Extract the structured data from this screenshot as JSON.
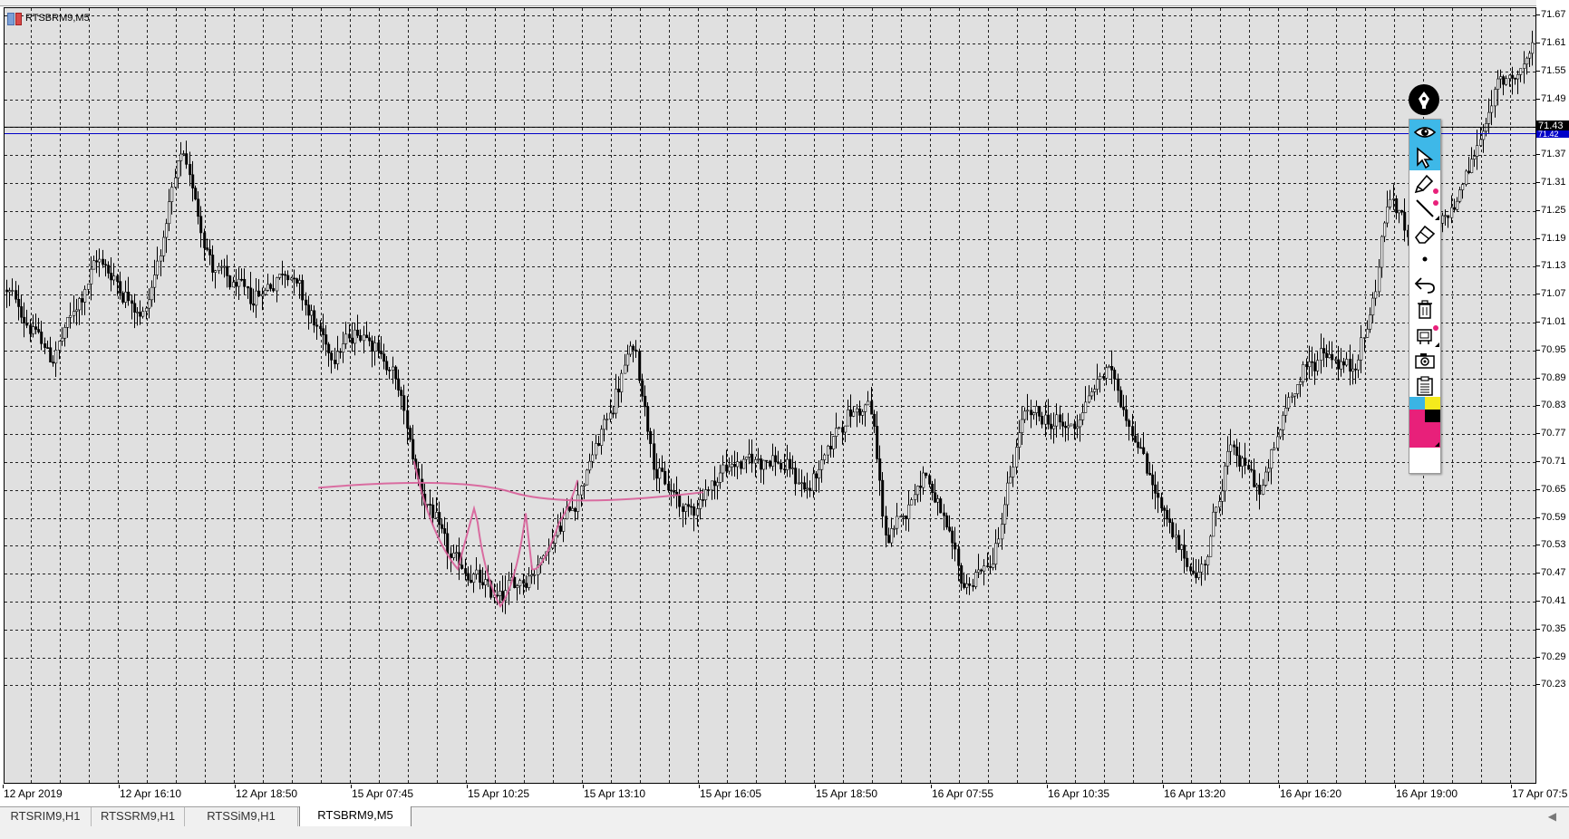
{
  "chart": {
    "symbol_title": "RTSBRM9,M5",
    "price_labels": [
      "71.67",
      "71.61",
      "71.55",
      "71.49",
      "71.43",
      "71.37",
      "71.31",
      "71.25",
      "71.19",
      "71.13",
      "71.07",
      "71.01",
      "70.95",
      "70.89",
      "70.83",
      "70.77",
      "70.71",
      "70.65",
      "70.59",
      "70.53",
      "70.47",
      "70.41",
      "70.35",
      "70.29",
      "70.23"
    ],
    "current_price_label": "71.43",
    "blue_line_price_label": "71.42",
    "time_labels": [
      "12 Apr 2019",
      "12 Apr 16:10",
      "12 Apr 18:50",
      "15 Apr 07:45",
      "15 Apr 10:25",
      "15 Apr 13:10",
      "15 Apr 16:05",
      "15 Apr 18:50",
      "16 Apr 07:55",
      "16 Apr 10:35",
      "16 Apr 13:20",
      "16 Apr 16:20",
      "16 Apr 19:00",
      "17 Apr 07:5"
    ],
    "colors": {
      "background": "#e0e0e0",
      "grid": "#000000",
      "candle": "#000000",
      "ask_line": "#0000c8",
      "bid_line": "#000000",
      "drawing": "#d9609a"
    }
  },
  "chart_data": {
    "type": "candlestick",
    "title": "RTSBRM9,M5",
    "ylim": [
      70.2,
      71.67
    ],
    "y_ticks": [
      71.67,
      71.61,
      71.55,
      71.49,
      71.43,
      71.37,
      71.31,
      71.25,
      71.19,
      71.13,
      71.07,
      71.01,
      70.95,
      70.89,
      70.83,
      70.77,
      70.71,
      70.65,
      70.59,
      70.53,
      70.47,
      70.41,
      70.35,
      70.29,
      70.23
    ],
    "x_ticks": [
      "12 Apr 2019",
      "12 Apr 16:10",
      "12 Apr 18:50",
      "15 Apr 07:45",
      "15 Apr 10:25",
      "15 Apr 13:10",
      "15 Apr 16:05",
      "15 Apr 18:50",
      "16 Apr 07:55",
      "16 Apr 10:35",
      "16 Apr 13:20",
      "16 Apr 16:20",
      "16 Apr 19:00",
      "17 Apr 07:5"
    ],
    "grid": true,
    "anchors": [
      {
        "x": 0,
        "y": 71.08
      },
      {
        "x": 0.03,
        "y": 70.93
      },
      {
        "x": 0.06,
        "y": 71.15
      },
      {
        "x": 0.09,
        "y": 71.02
      },
      {
        "x": 0.115,
        "y": 71.38
      },
      {
        "x": 0.135,
        "y": 71.12
      },
      {
        "x": 0.16,
        "y": 71.06
      },
      {
        "x": 0.185,
        "y": 71.13
      },
      {
        "x": 0.21,
        "y": 70.94
      },
      {
        "x": 0.235,
        "y": 71.0
      },
      {
        "x": 0.255,
        "y": 70.88
      },
      {
        "x": 0.27,
        "y": 70.66
      },
      {
        "x": 0.29,
        "y": 70.5
      },
      {
        "x": 0.32,
        "y": 70.42
      },
      {
        "x": 0.345,
        "y": 70.48
      },
      {
        "x": 0.37,
        "y": 70.62
      },
      {
        "x": 0.39,
        "y": 70.78
      },
      {
        "x": 0.41,
        "y": 70.97
      },
      {
        "x": 0.425,
        "y": 70.68
      },
      {
        "x": 0.445,
        "y": 70.6
      },
      {
        "x": 0.47,
        "y": 70.7
      },
      {
        "x": 0.5,
        "y": 70.72
      },
      {
        "x": 0.525,
        "y": 70.65
      },
      {
        "x": 0.545,
        "y": 70.8
      },
      {
        "x": 0.565,
        "y": 70.84
      },
      {
        "x": 0.575,
        "y": 70.52
      },
      {
        "x": 0.6,
        "y": 70.7
      },
      {
        "x": 0.625,
        "y": 70.44
      },
      {
        "x": 0.645,
        "y": 70.5
      },
      {
        "x": 0.665,
        "y": 70.82
      },
      {
        "x": 0.695,
        "y": 70.78
      },
      {
        "x": 0.72,
        "y": 70.92
      },
      {
        "x": 0.745,
        "y": 70.7
      },
      {
        "x": 0.765,
        "y": 70.52
      },
      {
        "x": 0.78,
        "y": 70.46
      },
      {
        "x": 0.8,
        "y": 70.75
      },
      {
        "x": 0.82,
        "y": 70.64
      },
      {
        "x": 0.84,
        "y": 70.87
      },
      {
        "x": 0.86,
        "y": 70.95
      },
      {
        "x": 0.88,
        "y": 70.9
      },
      {
        "x": 0.893,
        "y": 71.05
      },
      {
        "x": 0.903,
        "y": 71.29
      },
      {
        "x": 0.92,
        "y": 71.17
      },
      {
        "x": 0.94,
        "y": 71.22
      },
      {
        "x": 0.96,
        "y": 71.38
      },
      {
        "x": 0.975,
        "y": 71.52
      },
      {
        "x": 0.99,
        "y": 71.56
      },
      {
        "x": 1.0,
        "y": 71.6
      }
    ],
    "annotations": [
      "hand-drawn pink neckline near 70.64",
      "hand-drawn pink inverse head-and-shoulders around 15 Apr 10:25"
    ]
  },
  "tabs": [
    "RTSRIM9,H1",
    "RTSSRM9,H1",
    "RTSSiM9,H1",
    "RTSBRM9,M5"
  ],
  "active_tab": "RTSBRM9,M5",
  "tab_scroll_arrow": "◀",
  "toolbar": {
    "items": [
      "pen-icon",
      "eye-icon",
      "cursor-icon",
      "marker-icon",
      "line-icon",
      "eraser-icon",
      "dot-size-icon",
      "undo-icon",
      "trash-icon",
      "clear-all-icon",
      "camera-icon",
      "clipboard-icon"
    ],
    "palette_colors": [
      "#3ab4e4",
      "#f4ea1c",
      "#e8207a",
      "#000000",
      "#e8207a",
      "#e8207a"
    ]
  }
}
